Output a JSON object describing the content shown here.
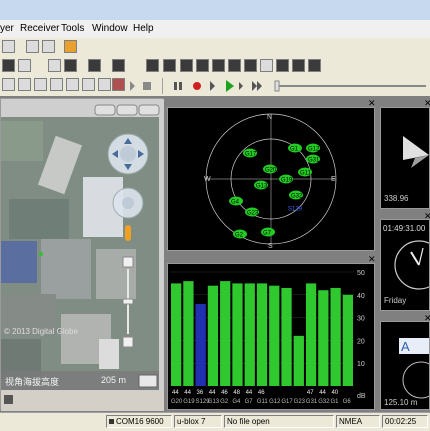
{
  "menu": [
    "yer",
    "Receiver",
    "Tools",
    "Window",
    "Help"
  ],
  "map": {
    "copyright": "© 2013 Digital Globe",
    "altitude_label": "视角海拔高度",
    "altitude_value": "205 m"
  },
  "sky": {
    "directions": {
      "n": "N",
      "e": "E",
      "s": "S",
      "w": "W"
    },
    "satellites": [
      "G1",
      "G12",
      "G17",
      "G31",
      "G20",
      "G11",
      "G19",
      "G13",
      "G4",
      "G32",
      "G23",
      "S129",
      "G7",
      "G2"
    ]
  },
  "signal": {
    "y_ticks": [
      "50",
      "40",
      "30",
      "20",
      "10"
    ],
    "unit": "dB"
  },
  "chart_data": {
    "type": "bar",
    "title": "",
    "ylim": [
      0,
      50
    ],
    "categories": [
      "G20",
      "G19",
      "S129",
      "G13",
      "G2",
      "G4",
      "G7",
      "G11",
      "G12",
      "G17",
      "G23",
      "G31",
      "G32",
      "G1",
      "G6"
    ],
    "values": [
      45,
      46,
      36,
      44,
      46,
      45,
      45,
      45,
      44,
      43,
      22,
      45,
      42,
      43,
      40
    ],
    "bar_labels": [
      "44",
      "44",
      "36",
      "44",
      "46",
      "48",
      "44",
      "46",
      "",
      "",
      "",
      "47",
      "44",
      "40",
      ""
    ],
    "colors": [
      "#2fc92f",
      "#2fc92f",
      "#2030b0",
      "#2fc92f",
      "#2fc92f",
      "#2fc92f",
      "#2fc92f",
      "#2fc92f",
      "#2fc92f",
      "#2fc92f",
      "#2fc92f",
      "#2fc92f",
      "#2fc92f",
      "#2fc92f",
      "#2fc92f"
    ]
  },
  "compass": {
    "value": "338.96"
  },
  "clock": {
    "time": "01:49:31.00",
    "day": "Friday"
  },
  "speed": {
    "value": "125.10 m"
  },
  "status": {
    "port": "COM16 9600",
    "receiver": "u-blox 7",
    "file": "No file open",
    "protocol": "NMEA",
    "time": "00:02:25"
  }
}
